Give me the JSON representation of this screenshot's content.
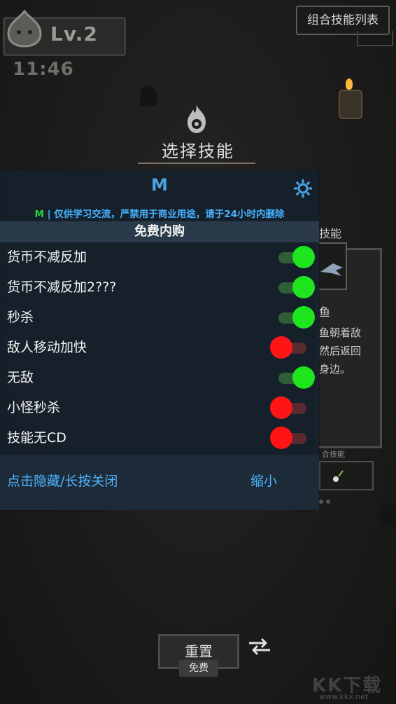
{
  "hud": {
    "level": "Lv.2",
    "timer": "11:46",
    "combo_skill_list": "组合技能列表"
  },
  "skill_select": {
    "title": "选择技能",
    "side_label": "技能",
    "side_title": "鱼",
    "side_desc_1": "鱼朝着敌",
    "side_desc_2": "然后返回",
    "side_desc_3": "身边。",
    "side_combo_label": "合技能"
  },
  "bottom": {
    "reset": "重置",
    "free": "免费"
  },
  "watermark": {
    "text": "KK下载",
    "url": "www.kkx.net"
  },
  "mod_menu": {
    "title": "M",
    "notice_prefix": "M",
    "notice": " | 仅供学习交流，严禁用于商业用途，请于24小时内删除",
    "section": "免费内购",
    "items": [
      {
        "label": "货币不减反加",
        "enabled": true
      },
      {
        "label": "货币不减反加2???",
        "enabled": true
      },
      {
        "label": "秒杀",
        "enabled": true
      },
      {
        "label": "敌人移动加快",
        "enabled": false
      },
      {
        "label": "无敌",
        "enabled": true
      },
      {
        "label": "小怪秒杀",
        "enabled": false
      },
      {
        "label": "技能无CD",
        "enabled": false
      }
    ],
    "footer_left": "点击隐藏/长按关闭",
    "footer_right": "缩小"
  },
  "colors": {
    "toggle_on": "#1fe51f",
    "toggle_off": "#ff1515",
    "accent_blue": "#4aa4e4",
    "notice_green": "#26d33a"
  },
  "icons": {
    "settings": "gear-icon",
    "swap": "swap-icon",
    "skill": "flame-skill-icon",
    "avatar": "slime-icon"
  }
}
